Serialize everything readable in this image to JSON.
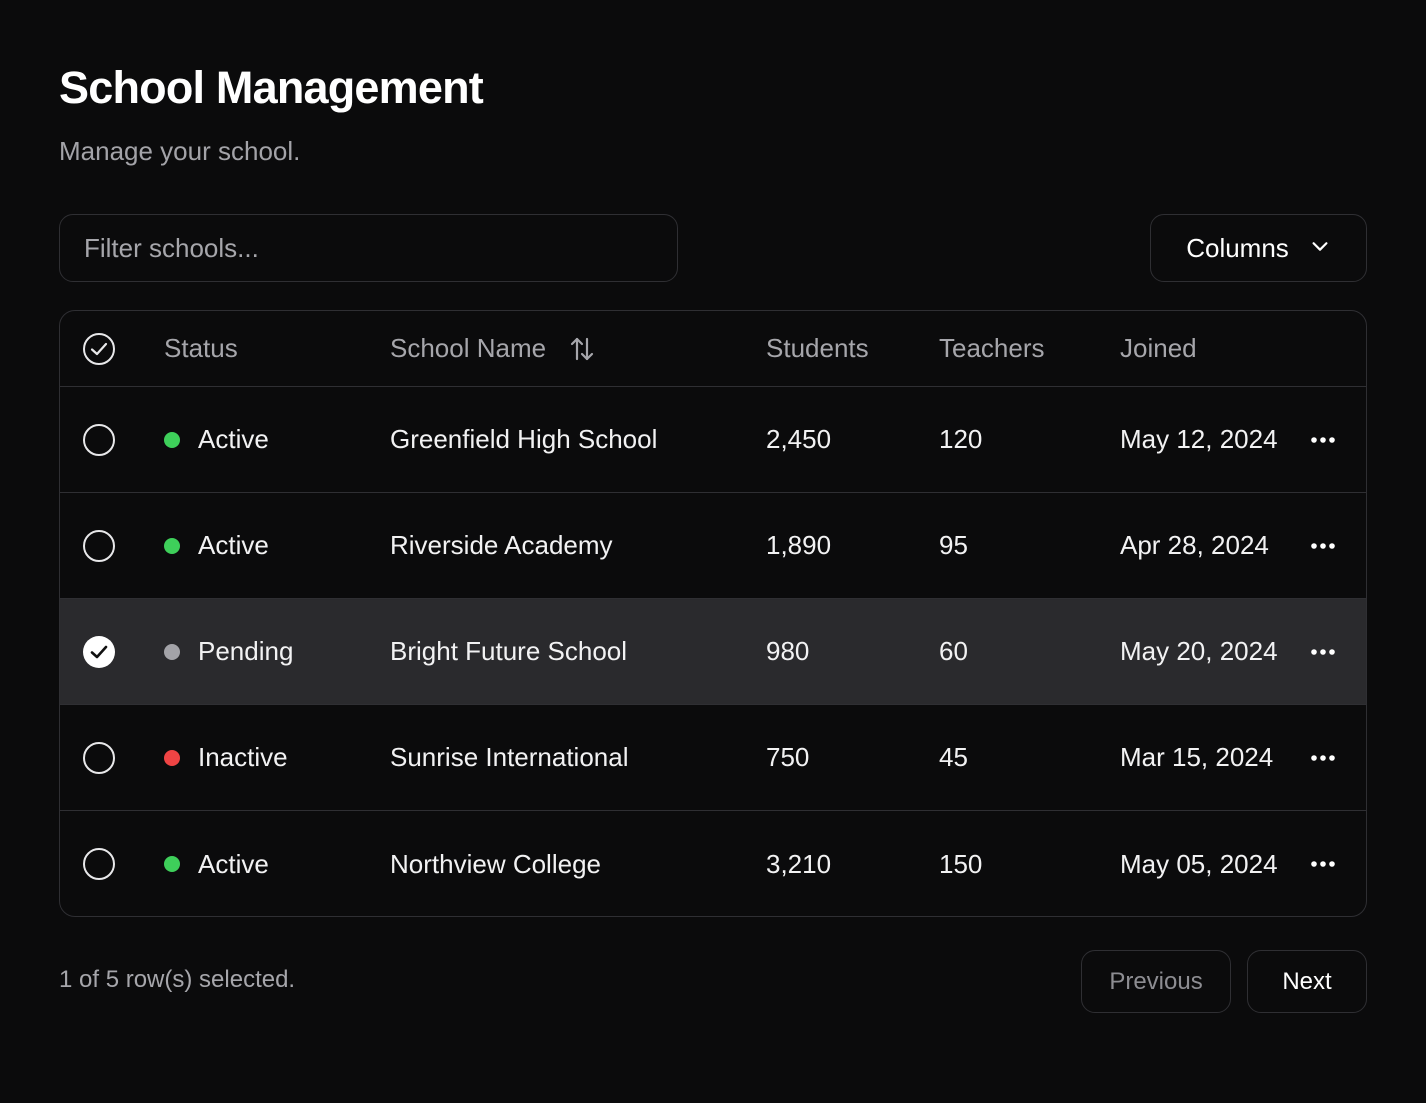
{
  "header": {
    "title": "School Management",
    "subtitle": "Manage your school."
  },
  "toolbar": {
    "filter_placeholder": "Filter schools...",
    "columns_label": "Columns"
  },
  "table": {
    "columns": {
      "status": "Status",
      "school_name": "School Name",
      "students": "Students",
      "teachers": "Teachers",
      "joined": "Joined"
    },
    "rows": [
      {
        "selected": false,
        "status": "Active",
        "status_color": "#3ecf5a",
        "name": "Greenfield High School",
        "students": "2,450",
        "teachers": "120",
        "joined": "May 12, 2024"
      },
      {
        "selected": false,
        "status": "Active",
        "status_color": "#3ecf5a",
        "name": "Riverside Academy",
        "students": "1,890",
        "teachers": "95",
        "joined": "Apr 28, 2024"
      },
      {
        "selected": true,
        "status": "Pending",
        "status_color": "#a3a3a8",
        "name": "Bright Future School",
        "students": "980",
        "teachers": "60",
        "joined": "May 20, 2024"
      },
      {
        "selected": false,
        "status": "Inactive",
        "status_color": "#ef4444",
        "name": "Sunrise International",
        "students": "750",
        "teachers": "45",
        "joined": "Mar 15, 2024"
      },
      {
        "selected": false,
        "status": "Active",
        "status_color": "#3ecf5a",
        "name": "Northview College",
        "students": "3,210",
        "teachers": "150",
        "joined": "May 05, 2024"
      }
    ]
  },
  "footer": {
    "selection_text": "1 of 5 row(s) selected.",
    "previous_label": "Previous",
    "next_label": "Next"
  },
  "icons": {
    "header_checkbox": "circle-check-icon",
    "sort": "sort-arrows-icon",
    "columns_dropdown": "chevron-down-icon",
    "row_actions": "more-horizontal-icon"
  }
}
